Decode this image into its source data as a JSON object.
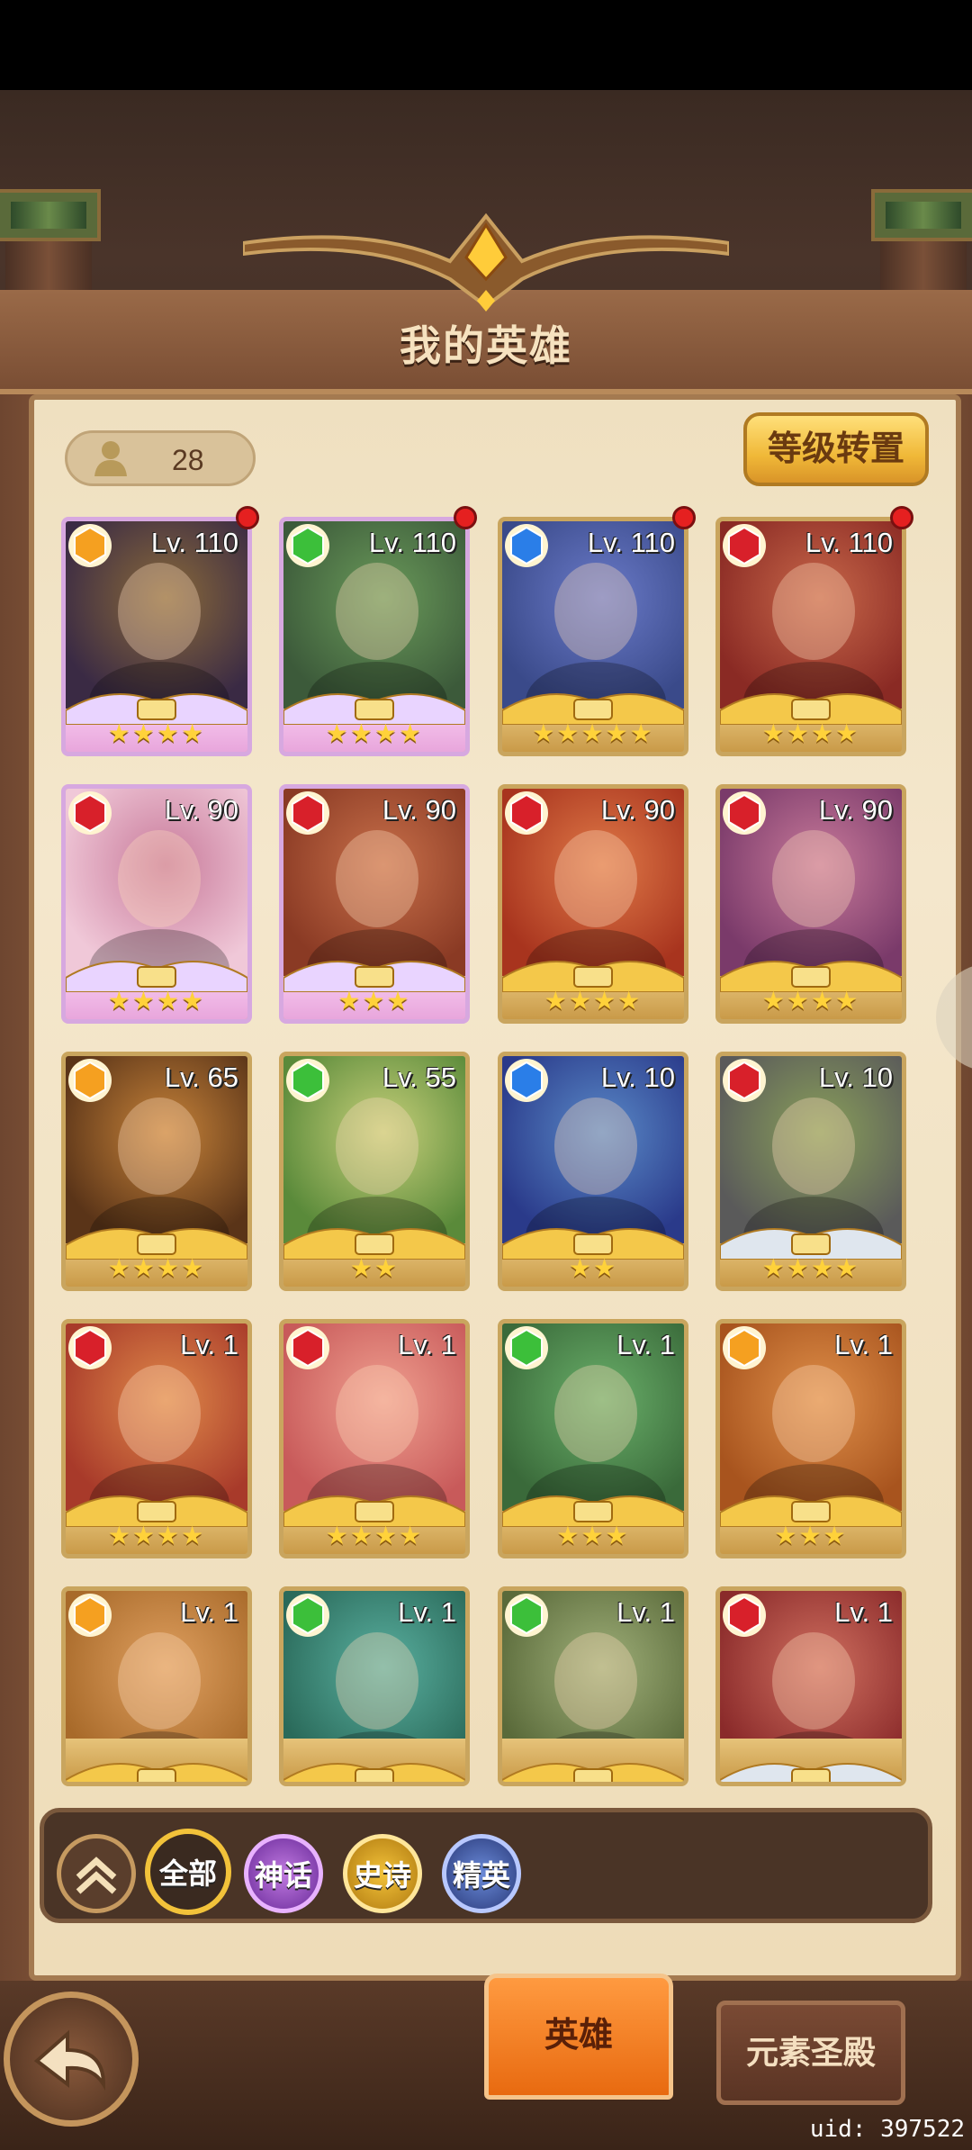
{
  "header": {
    "title": "我的英雄"
  },
  "hero_count": "28",
  "level_reset_button": "等级转置",
  "heroes": [
    {
      "level": "Lv. 110",
      "element": "fire",
      "stars": "★★★★",
      "rarity": "mythic",
      "notify": true
    },
    {
      "level": "Lv. 110",
      "element": "nature",
      "stars": "★★★★",
      "rarity": "mythic",
      "notify": true
    },
    {
      "level": "Lv. 110",
      "element": "water",
      "stars": "★★★★★",
      "rarity": "epic",
      "notify": true
    },
    {
      "level": "Lv. 110",
      "element": "red",
      "stars": "★★★★",
      "rarity": "epic",
      "notify": true
    },
    {
      "level": "Lv. 90",
      "element": "red",
      "stars": "★★★★",
      "rarity": "mythic",
      "notify": false
    },
    {
      "level": "Lv. 90",
      "element": "red",
      "stars": "★★★",
      "rarity": "mythic",
      "notify": false
    },
    {
      "level": "Lv. 90",
      "element": "red",
      "stars": "★★★★",
      "rarity": "epic",
      "notify": false
    },
    {
      "level": "Lv. 90",
      "element": "red",
      "stars": "★★★★",
      "rarity": "epic",
      "notify": false
    },
    {
      "level": "Lv. 65",
      "element": "fire",
      "stars": "★★★★",
      "rarity": "epic",
      "notify": false
    },
    {
      "level": "Lv. 55",
      "element": "nature",
      "stars": "★★",
      "rarity": "epic",
      "notify": false
    },
    {
      "level": "Lv. 10",
      "element": "water",
      "stars": "★★",
      "rarity": "epic",
      "notify": false
    },
    {
      "level": "Lv. 10",
      "element": "red",
      "stars": "★★★★",
      "rarity": "elite",
      "notify": false
    },
    {
      "level": "Lv. 1",
      "element": "red",
      "stars": "★★★★",
      "rarity": "epic",
      "notify": false
    },
    {
      "level": "Lv. 1",
      "element": "red",
      "stars": "★★★★",
      "rarity": "epic",
      "notify": false
    },
    {
      "level": "Lv. 1",
      "element": "nature",
      "stars": "★★★",
      "rarity": "epic",
      "notify": false
    },
    {
      "level": "Lv. 1",
      "element": "fire",
      "stars": "★★★",
      "rarity": "epic",
      "notify": false
    },
    {
      "level": "Lv. 1",
      "element": "fire",
      "stars": "",
      "rarity": "epic",
      "notify": false
    },
    {
      "level": "Lv. 1",
      "element": "nature",
      "stars": "",
      "rarity": "epic",
      "notify": false
    },
    {
      "level": "Lv. 1",
      "element": "nature",
      "stars": "",
      "rarity": "epic",
      "notify": false
    },
    {
      "level": "Lv. 1",
      "element": "red",
      "stars": "",
      "rarity": "elite",
      "notify": false
    }
  ],
  "filters": {
    "all": "全部",
    "mythic": "神话",
    "epic": "史诗",
    "elite": "精英"
  },
  "tabs": {
    "heroes": "英雄",
    "element_temple": "元素圣殿"
  },
  "uid": "uid: 397522",
  "colors": {
    "fire": "#f5a020",
    "nature": "#3cbf3a",
    "water": "#2a7ee8",
    "red": "#d8202a"
  },
  "portrait_palette": [
    [
      "#3a2a44",
      "#8a6a3a"
    ],
    [
      "#3c5a3a",
      "#6a9a5a"
    ],
    [
      "#3a4a8a",
      "#6a7ac8"
    ],
    [
      "#8a2a24",
      "#c8684a"
    ],
    [
      "#f0c8d8",
      "#c87a9a"
    ],
    [
      "#8a3a24",
      "#c8704a"
    ],
    [
      "#a8341e",
      "#e07a48"
    ],
    [
      "#7a3a6a",
      "#c87a9a"
    ],
    [
      "#5a3418",
      "#c8843a"
    ],
    [
      "#5a8a3a",
      "#c8d07a"
    ],
    [
      "#2a3a8a",
      "#5a8ac8"
    ],
    [
      "#5a5a5a",
      "#8aa05a"
    ],
    [
      "#a83a2a",
      "#e08a4a"
    ],
    [
      "#c85a5a",
      "#f0a090"
    ],
    [
      "#3a6a3a",
      "#6ab06a"
    ],
    [
      "#a8541e",
      "#e0904a"
    ],
    [
      "#a86a2a",
      "#e0a060"
    ],
    [
      "#2a6a5a",
      "#5ab0a0"
    ],
    [
      "#5a6a3a",
      "#a0b07a"
    ],
    [
      "#8a2a2a",
      "#d07060"
    ]
  ]
}
